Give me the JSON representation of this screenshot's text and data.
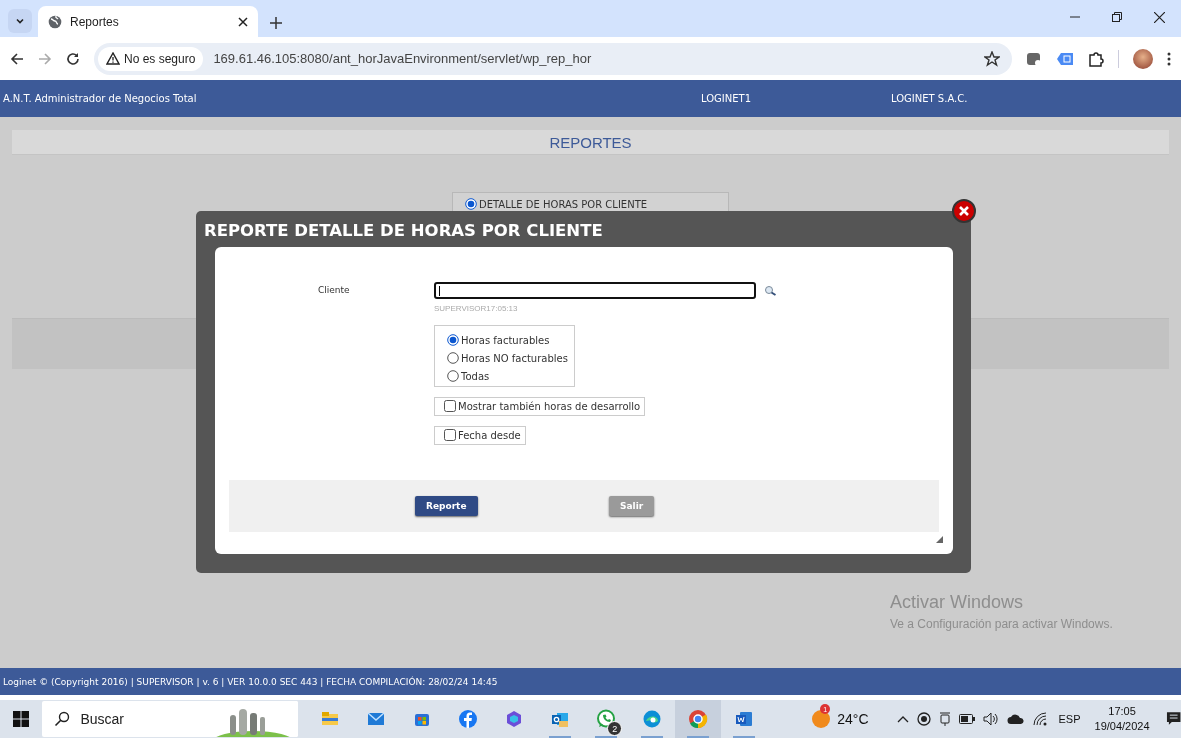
{
  "browser": {
    "tab": {
      "title": "Reportes"
    },
    "security": "No es seguro",
    "url": "169.61.46.105:8080/ant_horJavaEnvironment/servlet/wp_rep_hor"
  },
  "app_header": {
    "title": "A.N.T. Administrador de Negocios Total",
    "user": "LOGINET1",
    "company": "LOGINET S.A.C."
  },
  "page": {
    "heading": "REPORTES",
    "report_options": [
      {
        "label": "DETALLE DE HORAS POR CLIENTE",
        "selected": true
      }
    ]
  },
  "dialog": {
    "title": "REPORTE DETALLE DE HORAS POR CLIENTE",
    "client_label": "Cliente",
    "hint": "SUPERVISOR17:05:13",
    "hour_types": [
      {
        "label": "Horas facturables",
        "selected": true
      },
      {
        "label": "Horas NO facturables",
        "selected": false
      },
      {
        "label": "Todas",
        "selected": false
      }
    ],
    "options": [
      {
        "label": "Mostrar también horas de desarrollo",
        "checked": false
      },
      {
        "label": "Fecha desde",
        "checked": false
      }
    ],
    "buttons": [
      {
        "label": "Reporte",
        "kind": "primary"
      },
      {
        "label": "Salir",
        "kind": "secondary"
      }
    ]
  },
  "footer": "Loginet © (Copyright 2016) | SUPERVISOR | v. 6 | VER 10.0.0 SEC 443 | FECHA COMPILACIÓN: 28/02/24 14:45",
  "windows_activation": {
    "title": "Activar Windows",
    "subtitle": "Ve a Configuración para activar Windows."
  },
  "taskbar": {
    "search_placeholder": "Buscar",
    "apps": [
      {
        "kind": "files",
        "running": false,
        "selected": false
      },
      {
        "kind": "mail",
        "running": false,
        "selected": false
      },
      {
        "kind": "store",
        "running": false,
        "selected": false
      },
      {
        "kind": "facebook",
        "running": false,
        "selected": false
      },
      {
        "kind": "copilot",
        "running": false,
        "selected": false
      },
      {
        "kind": "outlook",
        "running": true,
        "selected": false
      },
      {
        "kind": "whatsapp",
        "running": true,
        "selected": false,
        "badge": "2"
      },
      {
        "kind": "edge",
        "running": true,
        "selected": false
      },
      {
        "kind": "chrome",
        "running": true,
        "selected": true
      },
      {
        "kind": "word",
        "running": true,
        "selected": false
      }
    ],
    "weather": {
      "temperature": "24°C",
      "badge": "1"
    },
    "language": "ESP",
    "time": "17:05",
    "date": "19/04/2024"
  }
}
